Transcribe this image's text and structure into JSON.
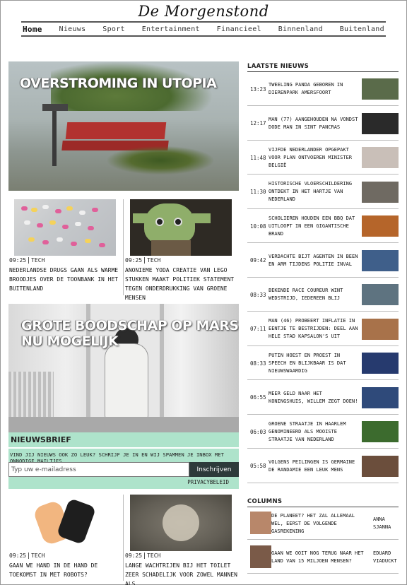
{
  "site": {
    "logo": "De Morgenstond"
  },
  "nav": [
    "Home",
    "Nieuws",
    "Sport",
    "Entertainment",
    "Financieel",
    "Binnenland",
    "Buitenland"
  ],
  "hero": {
    "headline": "OVERSTROMING IN UTOPIA"
  },
  "cards_top": [
    {
      "time": "09:25",
      "category": "TECH",
      "title": "NEDERLANDSE DRUGS GAAN ALS WARME BROODJES OVER DE TOONBANK IN HET BUITENLAND"
    },
    {
      "time": "09:25",
      "category": "TECH",
      "title": "ANONIEME YODA CREATIE VAN LEGO STUKKEN MAAKT POLITIEK STATEMENT TEGEN ONDERDRUKKING VAN GROENE MENSEN"
    }
  ],
  "feature": {
    "headline": "GROTE BOODSCHAP OP MARS NU MOGELIJK"
  },
  "newsletter": {
    "title": "NIEUWSBRIEF",
    "description": "VIND JIJ NIEUWS OOK ZO LEUK? SCHRIJF JE IN EN WIJ SPAMMEN JE INBOX MET ONNODIGE MAILTJES",
    "placeholder": "Typ uw e-mailadress",
    "button": "Inschrijven",
    "privacy": "PRIVACYBELEID"
  },
  "cards_bottom": [
    {
      "time": "09:25",
      "category": "TECH",
      "title": "GAAN WE HAND IN DE HAND DE TOEKOMST IN MET ROBOTS?"
    },
    {
      "time": "09:25",
      "category": "TECH",
      "title": "LANGE WACHTRIJEN BIJ HET TOILET ZEER SCHADELIJK VOOR ZOWEL MANNEN ALS"
    }
  ],
  "latest": {
    "heading": "LAATSTE NIEUWS",
    "items": [
      {
        "time": "13:23",
        "title": "TWEELING PANDA GEBOREN IN DIERENPARK AMERSFOORT",
        "color": "#5a6b4a"
      },
      {
        "time": "12:17",
        "title": "MAN (77) AANGEHOUDEN NA VONDST DODE MAN IN SINT PANCRAS",
        "color": "#2a2a2a"
      },
      {
        "time": "11:48",
        "title": "VIJFDE NEDERLANDER OPGEPAKT VOOR PLAN ONTVOEREN MINISTER BELGIË",
        "color": "#c9bfb8"
      },
      {
        "time": "11:30",
        "title": "HISTORISCHE VLOERSCHILDERING ONTDEKT IN HET HARTJE VAN NEDERLAND",
        "color": "#6f6a62"
      },
      {
        "time": "10:08",
        "title": "SCHOLIEREN HOUDEN EEN BBQ DAT UITLOOPT IN EEN GIGANTISCHE BRAND",
        "color": "#b5652a"
      },
      {
        "time": "09:42",
        "title": "VERDACHTE BIJT AGENTEN IN BEEN EN ARM TIJDENS POLITIE INVAL",
        "color": "#3f5f8a"
      },
      {
        "time": "08:33",
        "title": "BEKENDE RACE COUREUR WINT WEDSTRIJD, IEDEREEN BLIJ",
        "color": "#5e7380"
      },
      {
        "time": "07:11",
        "title": "MAN (46) PROBEERT INFLATIE IN EENTJE TE BESTRIJDEN: DEEL AAN HELE STAD KAPSALON'S UIT",
        "color": "#a8724a"
      },
      {
        "time": "08:33",
        "title": "PUTIN HOEST EN PROEST IN SPEECH EN BLIJKBAAR IS DAT NIEUWSWAARDIG",
        "color": "#263a6e"
      },
      {
        "time": "06:55",
        "title": "MEER GELD NAAR HET KONINGSHUIS, WILLEM ZEGT DOEN!",
        "color": "#2f4a7a"
      },
      {
        "time": "06:03",
        "title": "GROENE STRAATJE IN HAARLEM GENOMINEERD ALS MOOISTE STRAATJE VAN NEDERLAND",
        "color": "#3c6b2e"
      },
      {
        "time": "05:58",
        "title": "VOLGENS PEILINGEN IS GERMAINE DE RANDAMIE EEN LEUK MENS",
        "color": "#6b4e3c"
      }
    ]
  },
  "columns": {
    "heading": "COLUMNS",
    "items": [
      {
        "title": "DE PLANEET? HET ZAL ALLEMAAL WEL, EERST DE VOLGENDE GASREKENING",
        "author": "ANNA SJANNA",
        "color": "#b8876a"
      },
      {
        "title": "GAAN WE OOIT NOG TERUG NAAR HET LAND VAN 15 MILJOEN MENSEN?",
        "author": "EDUARD VIADUCKT",
        "color": "#7a5a48"
      }
    ]
  }
}
